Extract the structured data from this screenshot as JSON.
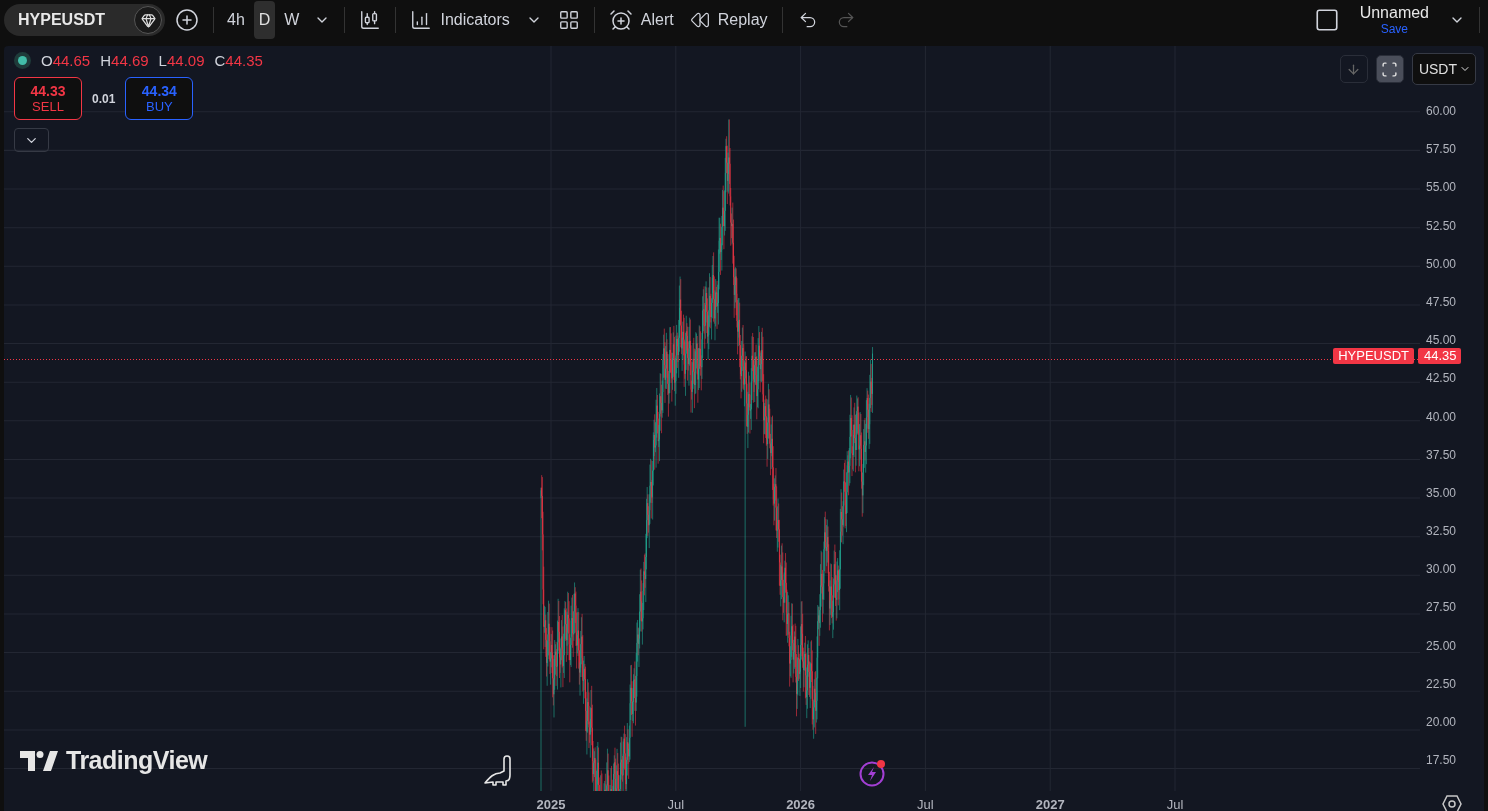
{
  "toolbar": {
    "symbol": "HYPEUSDT",
    "intervals": [
      {
        "label": "4h",
        "selected": false
      },
      {
        "label": "D",
        "selected": true
      },
      {
        "label": "W",
        "selected": false
      }
    ],
    "indicators_label": "Indicators",
    "alert_label": "Alert",
    "replay_label": "Replay",
    "layout_name": "Unnamed",
    "save_label": "Save"
  },
  "chart": {
    "legend": {
      "ohlc": [
        {
          "label": "O",
          "value": "44.65"
        },
        {
          "label": "H",
          "value": "44.69"
        },
        {
          "label": "L",
          "value": "44.09"
        },
        {
          "label": "C",
          "value": "44.35"
        }
      ]
    },
    "trade": {
      "sell": {
        "price": "44.33",
        "label": "SELL"
      },
      "spread": "0.01",
      "buy": {
        "price": "44.34",
        "label": "BUY"
      }
    },
    "currency": "USDT",
    "price_line": {
      "symbol": "HYPEUSDT",
      "price": "44.35"
    },
    "price_axis": [
      "60.00",
      "57.50",
      "55.00",
      "52.50",
      "50.00",
      "47.50",
      "45.00",
      "42.50",
      "40.00",
      "37.50",
      "35.00",
      "32.50",
      "30.00",
      "27.50",
      "25.00",
      "22.50",
      "20.00",
      "17.50"
    ],
    "time_axis": [
      {
        "label": "2025",
        "bold": true
      },
      {
        "label": "Jul",
        "bold": false
      },
      {
        "label": "2026",
        "bold": true
      },
      {
        "label": "Jul",
        "bold": false
      },
      {
        "label": "2027",
        "bold": true
      },
      {
        "label": "Jul",
        "bold": false
      }
    ],
    "logo": "TradingView"
  }
}
